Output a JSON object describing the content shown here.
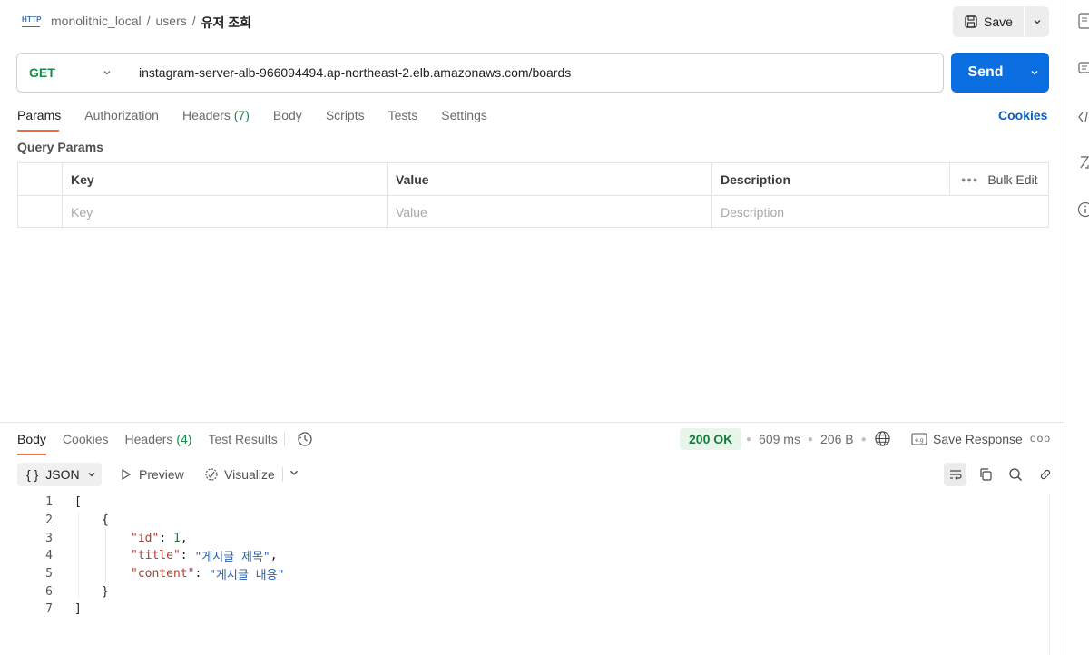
{
  "header": {
    "http_icon": "HTTP",
    "breadcrumb": [
      "monolithic_local",
      "users",
      "유저 조회"
    ],
    "save_label": "Save"
  },
  "request": {
    "method": "GET",
    "url": "instagram-server-alb-966094494.ap-northeast-2.elb.amazonaws.com/boards",
    "send_label": "Send"
  },
  "request_tabs": {
    "params": "Params",
    "authorization": "Authorization",
    "headers": "Headers",
    "headers_count": "(7)",
    "body": "Body",
    "scripts": "Scripts",
    "tests": "Tests",
    "settings": "Settings",
    "cookies": "Cookies",
    "active": "Params"
  },
  "query_params": {
    "title": "Query Params",
    "columns": [
      "Key",
      "Value",
      "Description"
    ],
    "bulk_edit": "Bulk Edit",
    "placeholders": {
      "key": "Key",
      "value": "Value",
      "description": "Description"
    }
  },
  "response_tabs": {
    "body": "Body",
    "cookies": "Cookies",
    "headers": "Headers",
    "headers_count": "(4)",
    "test_results": "Test Results",
    "active": "Body"
  },
  "response_meta": {
    "status": "200 OK",
    "time": "609 ms",
    "size": "206 B",
    "save_response": "Save Response"
  },
  "response_toolbar": {
    "format": "JSON",
    "format_icon": "{ }",
    "preview": "Preview",
    "visualize": "Visualize"
  },
  "colors": {
    "method": "#1a8a4a",
    "send": "#0b6ee0",
    "accent_underline": "#f26b3a",
    "status_bg": "#e7f5ea",
    "status_text": "#1a7a3e",
    "link": "#0b5fc4"
  },
  "code": {
    "line_numbers": [
      "1",
      "2",
      "3",
      "4",
      "5",
      "6",
      "7"
    ],
    "open_bracket": "[",
    "open_brace": "{",
    "id_key": "\"id\"",
    "id_value": "1",
    "title_key": "\"title\"",
    "title_value": "\"게시글 제목\"",
    "content_key": "\"content\"",
    "content_value": "\"게시글 내용\"",
    "close_brace": "}",
    "close_bracket": "]"
  }
}
